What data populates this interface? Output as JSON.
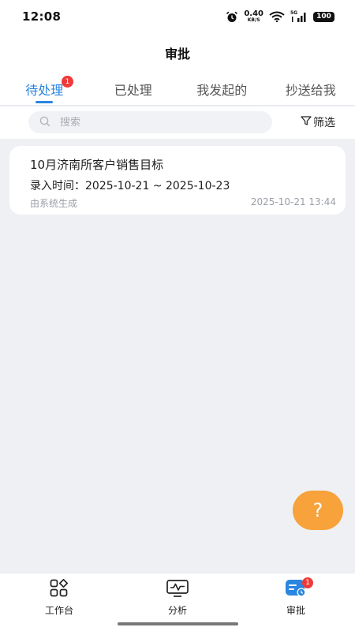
{
  "status_bar": {
    "time": "12:08",
    "net_speed_value": "0.40",
    "net_speed_unit": "KB/S",
    "signal_label": "5G",
    "battery": "100",
    "icons": [
      "alarm-icon",
      "wifi-icon",
      "signal-icon",
      "battery-icon"
    ]
  },
  "header": {
    "title": "审批"
  },
  "tabs": [
    {
      "label": "待处理",
      "active": true,
      "badge": "1"
    },
    {
      "label": "已处理",
      "active": false
    },
    {
      "label": "我发起的",
      "active": false
    },
    {
      "label": "抄送给我",
      "active": false
    }
  ],
  "search": {
    "placeholder": "搜索",
    "value": ""
  },
  "filter": {
    "label": "筛选",
    "icon": "filter-icon"
  },
  "items": [
    {
      "title": "10月济南所客户销售目标",
      "period": "录入时间：2025-10-21 ~ 2025-10-23",
      "source": "由系统生成",
      "timestamp": "2025-10-21 13:44"
    }
  ],
  "help_button": {
    "label": "?"
  },
  "bottom_nav": [
    {
      "label": "工作台",
      "icon": "workbench-grid-icon"
    },
    {
      "label": "分析",
      "icon": "analysis-monitor-icon"
    },
    {
      "label": "审批",
      "icon": "approval-icon",
      "active": true,
      "badge": "1"
    }
  ],
  "colors": {
    "accent": "#2a86e0",
    "badge": "#f03a3a",
    "help_fab": "#f7a23a",
    "background": "#eef0f4"
  }
}
